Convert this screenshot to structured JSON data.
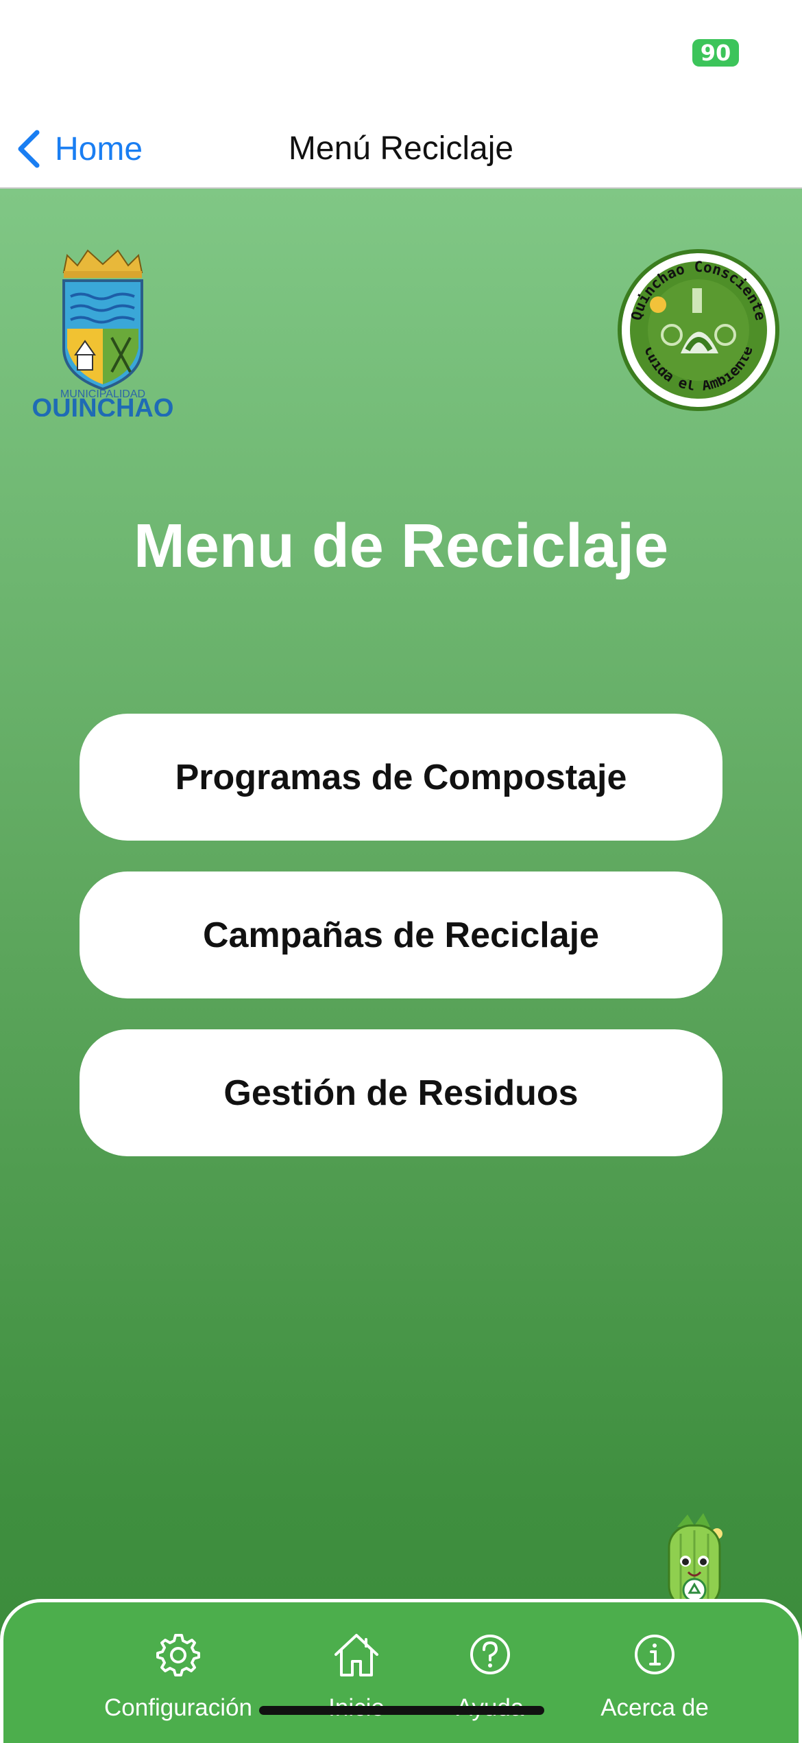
{
  "status_bar": {
    "battery": "90"
  },
  "nav": {
    "back_label": "Home",
    "title": "Menú Reciclaje"
  },
  "logos": {
    "left_caption_small": "MUNICIPALIDAD",
    "left_caption_big": "QUINCHAO",
    "right_text_top": "Quinchao Consciente",
    "right_text_bottom": "Cuida el Ambiente"
  },
  "main": {
    "title": "Menu de Reciclaje",
    "buttons": [
      {
        "label": "Programas de Compostaje"
      },
      {
        "label": "Campañas de Reciclaje"
      },
      {
        "label": "Gestión de Residuos"
      }
    ]
  },
  "tabbar": {
    "tabs": [
      {
        "label": "Configuración",
        "icon": "gear-icon"
      },
      {
        "label": "Inicio",
        "icon": "home-icon"
      },
      {
        "label": "Ayuda",
        "icon": "help-icon"
      },
      {
        "label": "Acerca de",
        "icon": "info-icon"
      }
    ]
  },
  "colors": {
    "accent_blue": "#1a7ef2",
    "gradient_top": "#80c785",
    "gradient_bottom": "#3a8b3a",
    "tabbar_green": "#4cae4c",
    "battery_green": "#3cc45a"
  }
}
